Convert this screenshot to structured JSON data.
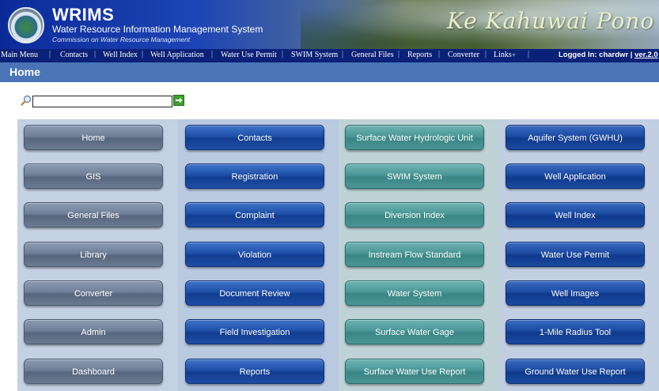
{
  "header": {
    "brand": "WRIMS",
    "subtitle": "Water Resource Information Management System",
    "subsubtitle": "Commission on Water Resource Management",
    "script_text": "Ke Kahuwai Pono"
  },
  "menu": {
    "items": [
      "Main Menu",
      "Contacts",
      "Well Index",
      "Well Application",
      "Water Use Permit",
      "SWIM System",
      "General Files",
      "Reports",
      "Converter",
      "Links"
    ],
    "logged_in_label": "Logged In: chardwr |",
    "version": "ver.2.0"
  },
  "page": {
    "title": "Home"
  },
  "search": {
    "value": "",
    "placeholder": ""
  },
  "columns": [
    [
      "Home",
      "GIS",
      "General Files",
      "Library",
      "Converter",
      "Admin",
      "Dashboard"
    ],
    [
      "Contacts",
      "Registration",
      "Complaint",
      "Violation",
      "Document Review",
      "Field Investigation",
      "Reports"
    ],
    [
      "Surface Water Hydrologic Unit",
      "SWIM System",
      "Diversion Index",
      "Instream Flow Standard",
      "Water System",
      "Surface Water Gage",
      "Surface Water Use Report"
    ],
    [
      "Aquifer System (GWHU)",
      "Well Application",
      "Well Index",
      "Water Use Permit",
      "Well Images",
      "1-Mile Radius Tool",
      "Ground Water Use Report"
    ]
  ],
  "colors": {
    "banner": "#1d45b5",
    "menubar": "#0a2178",
    "homebar": "#4a74b6",
    "col1_buttons": "#6e7f97",
    "col2_buttons": "#1e4fa8",
    "col3_buttons": "#4a9797",
    "col4_buttons": "#1b4aa2"
  }
}
